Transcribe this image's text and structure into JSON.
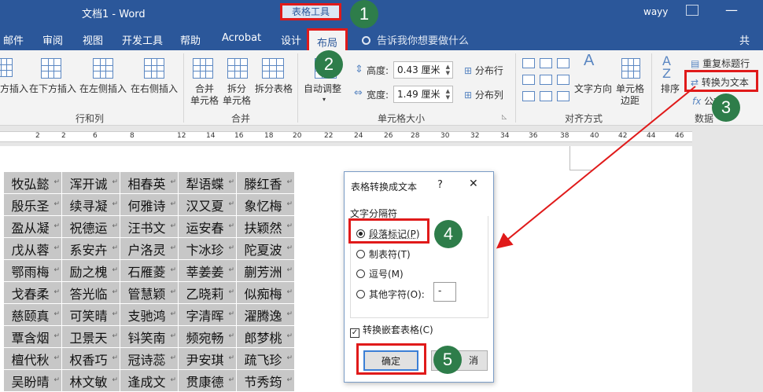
{
  "titlebar": {
    "document": "文档1  -  Word",
    "context_tab": "表格工具",
    "user": "wayy"
  },
  "tabs": [
    "邮件",
    "审阅",
    "视图",
    "开发工具",
    "帮助",
    "Acrobat",
    "设计",
    "布局"
  ],
  "active_tab": "布局",
  "search_placeholder": "告诉我你想要做什么",
  "share_label": "共",
  "ribbon": {
    "rows_cols": {
      "insert_above_partial": "方插入",
      "insert_below": "在下方插入",
      "insert_left": "在左侧插入",
      "insert_right": "在右侧插入",
      "group_label": "行和列"
    },
    "merge": {
      "merge_cells": [
        "合并",
        "单元格"
      ],
      "split_cells": [
        "拆分",
        "单元格"
      ],
      "split_table": "拆分表格",
      "group_label": "合并"
    },
    "cell_size": {
      "autofit": "自动调整",
      "height_label": "高度:",
      "height_value": "0.43 厘米",
      "width_label": "宽度:",
      "width_value": "1.49 厘米",
      "distribute_rows": "分布行",
      "distribute_cols": "分布列",
      "group_label": "单元格大小"
    },
    "alignment": {
      "text_direction": "文字方向",
      "cell_margins": [
        "单元格",
        "边距"
      ],
      "group_label": "对齐方式"
    },
    "data": {
      "sort": "排序",
      "repeat_header": "重复标题行",
      "convert_to_text": "转换为文本",
      "formula": "公式",
      "group_label": "数据"
    }
  },
  "ruler_numbers": [
    "2",
    "2",
    "6",
    "8",
    "12",
    "14",
    "16",
    "18",
    "20",
    "22",
    "24",
    "26",
    "28",
    "30",
    "32",
    "34",
    "36",
    "38",
    "40",
    "42",
    "44",
    "46"
  ],
  "table_rows": [
    [
      "牧弘懿",
      "浑开诚",
      "相春英",
      "犁语蝶",
      "滕红香"
    ],
    [
      "殷乐圣",
      "续寻凝",
      "何雅诗",
      "汉又夏",
      "象忆梅"
    ],
    [
      "盈从凝",
      "祝德运",
      "汪书文",
      "运安春",
      "扶颖然"
    ],
    [
      "戊从蓉",
      "系安卉",
      "户洛灵",
      "卞冰珍",
      "陀夏波"
    ],
    [
      "鄂雨梅",
      "励之槐",
      "石雁菱",
      "莘姜姜",
      "蒯芳洲"
    ],
    [
      "戈春柔",
      "答光临",
      "管慧颖",
      "乙晓莉",
      "似痴梅"
    ],
    [
      "慈颐真",
      "可笑晴",
      "支驰鸿",
      "字清晖",
      "濯腾逸"
    ],
    [
      "覃含烟",
      "卫景天",
      "钭笑南",
      "频宛畅",
      "郎梦桃"
    ],
    [
      "檀代秋",
      "权香巧",
      "冠诗蕊",
      "尹安琪",
      "疏飞珍"
    ],
    [
      "吴盼晴",
      "林文敏",
      "逢成文",
      "贯康德",
      "节秀筠"
    ]
  ],
  "dialog": {
    "title": "表格转换成文本",
    "help": "?",
    "close": "✕",
    "group_title": "文字分隔符",
    "options": [
      "段落标记(P)",
      "制表符(T)",
      "逗号(M)",
      "其他字符(O):"
    ],
    "selected_option": "段落标记(P)",
    "other_char_value": "-",
    "nested_checkbox": "转换嵌套表格(C)",
    "nested_checked": true,
    "ok": "确定",
    "cancel_partial": "消"
  },
  "badges": [
    "1",
    "2",
    "3",
    "4",
    "5"
  ],
  "colors": {
    "title_bar": "#2b579a",
    "highlight": "#e01a1a",
    "badge": "#2e7d4a",
    "table_cell": "#c7c7c7"
  }
}
